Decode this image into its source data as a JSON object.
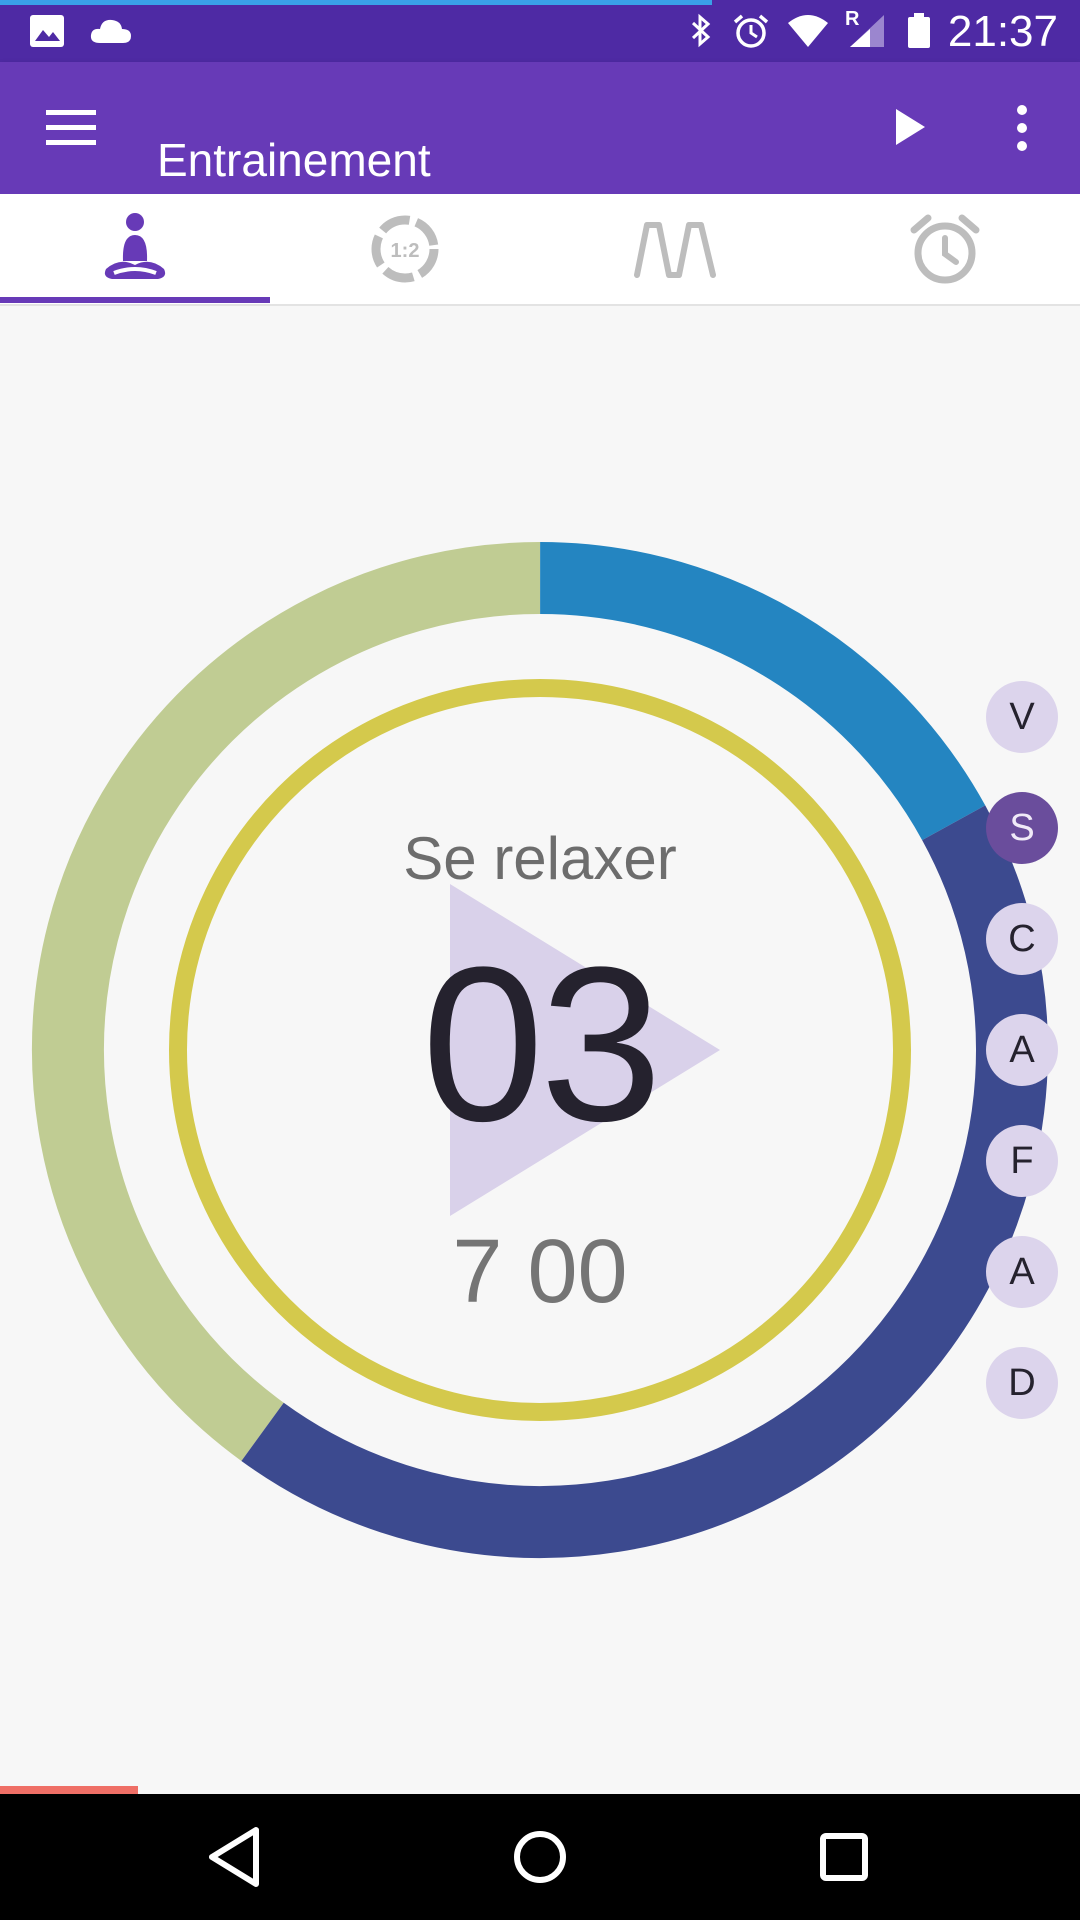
{
  "status_bar": {
    "time": "21:37",
    "icons": [
      "image-icon",
      "cloud-icon",
      "bluetooth-icon",
      "alarm-icon",
      "wifi-icon",
      "signal-icon",
      "battery-icon"
    ],
    "roaming_indicator": "R"
  },
  "app_bar": {
    "title": "Entrainement",
    "icons": [
      "menu-icon",
      "play-icon",
      "more-vert-icon"
    ]
  },
  "tabs": [
    {
      "icon": "meditation-icon",
      "selected": true
    },
    {
      "icon": "ratio-1-2-icon",
      "label": "1:2",
      "selected": false
    },
    {
      "icon": "breath-pattern-icon",
      "selected": false
    },
    {
      "icon": "alarm-clock-icon",
      "selected": false
    }
  ],
  "timer": {
    "phase": "Se relaxer",
    "count": "03",
    "duration": "7  00",
    "ring_segments": [
      {
        "color": "#c0cc93",
        "share": 0.4
      },
      {
        "color": "#2485c1",
        "share": 0.17
      },
      {
        "color": "#3c4a8f",
        "share": 0.43
      }
    ],
    "inner_ring_color": "#d4c94c",
    "play_overlay_color": "#d9d1ea"
  },
  "side_bubbles": [
    {
      "letter": "V",
      "active": false
    },
    {
      "letter": "S",
      "active": true
    },
    {
      "letter": "C",
      "active": false
    },
    {
      "letter": "A",
      "active": false
    },
    {
      "letter": "F",
      "active": false
    },
    {
      "letter": "A",
      "active": false
    },
    {
      "letter": "D",
      "active": false
    }
  ],
  "colors": {
    "primary": "#673ab7",
    "primary_dark": "#4e2aa4",
    "accent": "#ef6f66"
  },
  "nav_bar": {
    "icons": [
      "back-icon",
      "home-icon",
      "recents-icon"
    ]
  }
}
